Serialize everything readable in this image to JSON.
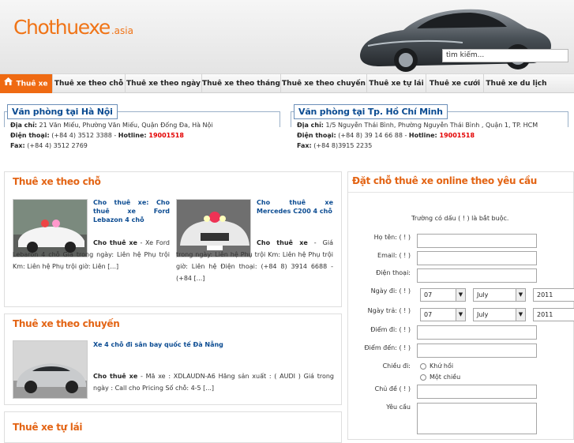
{
  "header": {
    "logo_main": "Chothuexe",
    "logo_suffix": ".asia",
    "search_placeholder": "tìm kiếm..."
  },
  "nav": {
    "items": [
      {
        "label": "Thuê xe"
      },
      {
        "label": "Thuê xe theo chỗ"
      },
      {
        "label": "Thuê xe theo ngày"
      },
      {
        "label": "Thuê xe theo tháng"
      },
      {
        "label": "Thuê xe theo chuyến"
      },
      {
        "label": "Thuê xe tự lái"
      },
      {
        "label": "Thuê xe cưới"
      },
      {
        "label": "Thuê xe du lịch"
      }
    ]
  },
  "offices": [
    {
      "title": "Văn phòng tại Hà Nội",
      "addr_label": "Địa chỉ:",
      "addr": " 21 Văn Miếu, Phường Văn Miếu, Quận Đống Đa, Hà Nội",
      "phone_label": "Điện thoại:",
      "phone": " (+84 4) 3512 3388 - ",
      "hotline_label": "Hotline:",
      "hotline": " 19001518",
      "fax_label": "Fax:",
      "fax": " (+84 4) 3512 2769"
    },
    {
      "title": "Văn phòng tại Tp. Hồ Chí Minh",
      "addr_label": "Địa chỉ:",
      "addr": " 1/5 Nguyễn Thái Bình, Phường Nguyễn Thái Bình , Quận 1, TP. HCM",
      "phone_label": "Điện thoại:",
      "phone": " (+84 8) 39 14 66 88 - ",
      "hotline_label": "Hotline:",
      "hotline": " 19001518",
      "fax_label": "Fax:",
      "fax": " (+84 8)3915 2235"
    }
  ],
  "sections": {
    "by_seat": {
      "title": "Thuê xe theo chỗ",
      "items": [
        {
          "link": "Cho thuê xe: Cho thuê xe Ford Lebazon 4 chỗ",
          "desc_label": "Cho thuê xe",
          "desc": " - Xe Ford Lebaron 4 chỗ Giá trong ngày: Liên hệ Phụ trội Km: Liên hệ Phụ trội giờ: Liên [...]"
        },
        {
          "link": "Cho thuê xe Mercedes C200 4 chỗ",
          "desc_label": "Cho thuê xe",
          "desc": " - Giá trong ngày: Liên hệ Phụ trội Km: Liên hệ Phụ trội giờ: Liên hệ Điện thoại: (+84 8) 3914 6688 - (+84 [...]"
        }
      ]
    },
    "by_trip": {
      "title": "Thuê xe theo chuyến",
      "items": [
        {
          "link": "Xe 4 chỗ đi sân bay quốc tế Đà Nẵng",
          "desc_label": "Cho thuê xe",
          "desc": " - Mã xe : XDLAUDN-A6 Hãng sản xuất : ( AUDI ) Giá trong ngày : Call cho Pricing Số chỗ: 4-5 [...]"
        }
      ]
    },
    "self_drive": {
      "title": "Thuê xe tự lái"
    }
  },
  "booking": {
    "title": "Đặt chỗ thuê xe online theo yêu cầu",
    "note": "Trường có dấu ( ! ) là bắt buộc.",
    "labels": {
      "name": "Họ tên:   ( ! )",
      "email": "Email:   ( ! )",
      "phone": "Điện thoại:",
      "start": "Ngày đi:   ( ! )",
      "end": "Ngày trả:   ( ! )",
      "from": "Điểm đi:   ( ! )",
      "to": "Điểm đến:   ( ! )",
      "direction": "Chiều đi:",
      "topic": "Chủ đề   ( ! )",
      "request": "Yêu cầu"
    },
    "day": "07",
    "month": "July",
    "year": "2011",
    "direction_options": [
      "Khứ hồi",
      "Một chiều"
    ]
  }
}
